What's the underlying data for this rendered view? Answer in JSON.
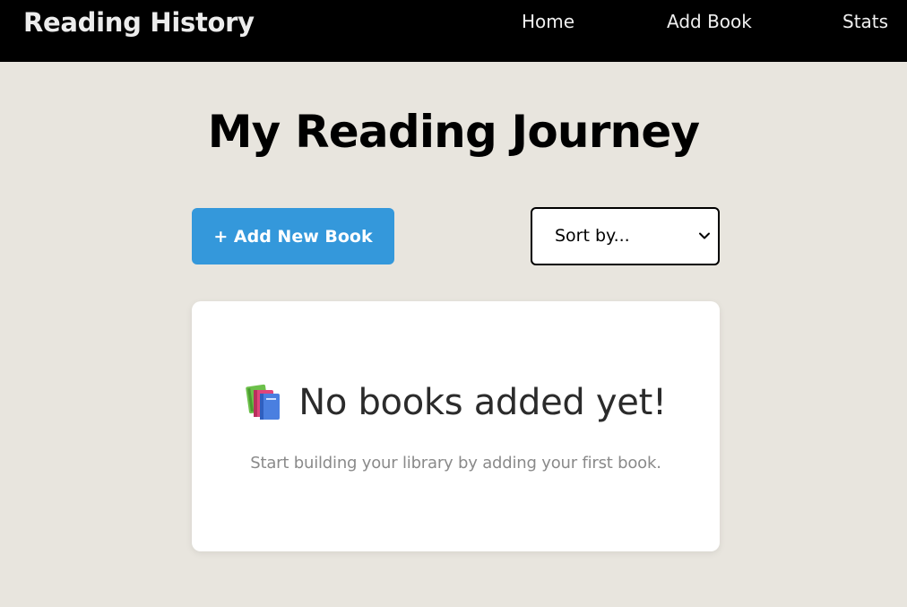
{
  "navbar": {
    "brand": "Reading History",
    "links": [
      {
        "label": "Home"
      },
      {
        "label": "Add Book"
      },
      {
        "label": "Stats"
      }
    ]
  },
  "main": {
    "title": "My Reading Journey",
    "add_button_label": "+ Add New Book",
    "sort": {
      "selected": "Sort by...",
      "icon": "chevron-down-icon"
    },
    "empty_state": {
      "icon": "books-icon",
      "title": "No books added yet!",
      "subtitle": "Start building your library by adding your first book."
    }
  },
  "colors": {
    "navbar_bg": "#000000",
    "page_bg": "#e8e5de",
    "accent": "#3498db",
    "card_bg": "#ffffff"
  }
}
